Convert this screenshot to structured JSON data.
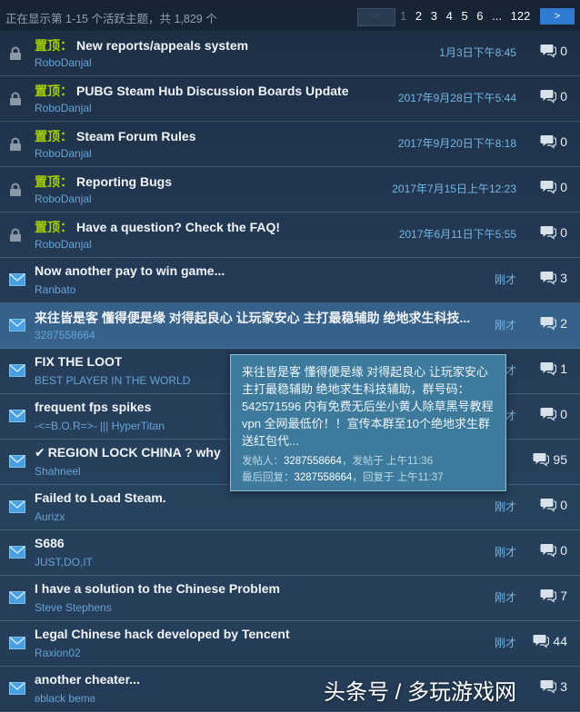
{
  "header": {
    "showing": "正在显示第 1-15 个活跃主题，共 1,829 个",
    "pages": [
      "1",
      "2",
      "3",
      "4",
      "5",
      "6",
      "...",
      "122"
    ],
    "next": ">"
  },
  "topics": [
    {
      "pin": "置顶：",
      "title": "New reports/appeals system",
      "author": "RoboDanjal",
      "date": "1月3日下午8:45",
      "count": "0",
      "icon": "lock-icon"
    },
    {
      "pin": "置顶：",
      "title": "PUBG Steam Hub Discussion Boards Update",
      "author": "RoboDanjal",
      "date": "2017年9月28日下午5:44",
      "count": "0",
      "icon": "lock-icon"
    },
    {
      "pin": "置顶：",
      "title": "Steam Forum Rules",
      "author": "RoboDanjal",
      "date": "2017年9月20日下午8:18",
      "count": "0",
      "icon": "lock-icon"
    },
    {
      "pin": "置顶：",
      "title": "Reporting Bugs",
      "author": "RoboDanjal",
      "date": "2017年7月15日上午12:23",
      "count": "0",
      "icon": "lock-icon"
    },
    {
      "pin": "置顶：",
      "title": "Have a question? Check the FAQ!",
      "author": "RoboDanjal",
      "date": "2017年6月11日下午5:55",
      "count": "0",
      "icon": "lock-icon"
    },
    {
      "pin": "",
      "title": "Now another pay to win game...",
      "author": "Ranbato",
      "date": "刚才",
      "count": "3",
      "icon": "envelope-icon"
    },
    {
      "pin": "",
      "title": "来往皆是客 懂得便是缘 对得起良心 让玩家安心 主打最稳辅助 绝地求生科技...",
      "author": "3287558664",
      "date": "刚才",
      "count": "2",
      "icon": "envelope-icon"
    },
    {
      "pin": "",
      "title": "FIX THE LOOT",
      "author": "BEST PLAYER IN THE WORLD",
      "date": "刚才",
      "count": "1",
      "icon": "envelope-icon"
    },
    {
      "pin": "",
      "title": "frequent fps spikes",
      "author": "-<=B.O.R=>- ||| HyperTitan",
      "date": "刚才",
      "count": "0",
      "icon": "envelope-icon"
    },
    {
      "pin": "",
      "title": "REGION LOCK CHINA ? why",
      "author": "Shahneel",
      "date": "",
      "count": "95",
      "icon": "envelope-icon"
    },
    {
      "pin": "",
      "title": "Failed to Load Steam.",
      "author": "Aurizx",
      "date": "刚才",
      "count": "0",
      "icon": "envelope-icon"
    },
    {
      "pin": "",
      "title": "S686",
      "author": "JUST,DO,IT",
      "date": "刚才",
      "count": "0",
      "icon": "envelope-icon"
    },
    {
      "pin": "",
      "title": "I have a solution to the Chinese Problem",
      "author": "Steve Stephens",
      "date": "刚才",
      "count": "7",
      "icon": "envelope-icon"
    },
    {
      "pin": "",
      "title": "Legal Chinese hack developed by Tencent",
      "author": "Raxion02",
      "date": "刚才",
      "count": "44",
      "icon": "envelope-icon"
    },
    {
      "pin": "",
      "title": "another cheater...",
      "author": "ʚblack bemɞ",
      "date": "",
      "count": "3",
      "icon": "envelope-icon"
    }
  ],
  "tooltip": {
    "text": "来往皆是客 懂得便是缘 对得起良心 让玩家安心 主打最稳辅助 绝地求生科技辅助，群号码：542571596 内有免费无后坐小黄人除草黑号教程vpn 全网最低价！！宣传本群至10个绝地求生群送红包代...",
    "poster_label": "发帖人：",
    "poster": "3287558664",
    "posted_at": "，发帖于 上午11:36",
    "reply_label": "最后回复：",
    "replier": "3287558664",
    "replied_at": "，回复于 上午11:37"
  },
  "watermark": "头条号 / 多玩游戏网",
  "colors": {
    "pin": "#a4d007",
    "author": "#66a4d6",
    "date": "#75b7e6",
    "next_button": "#2f7bd1",
    "tooltip": "#3d7a9c"
  }
}
